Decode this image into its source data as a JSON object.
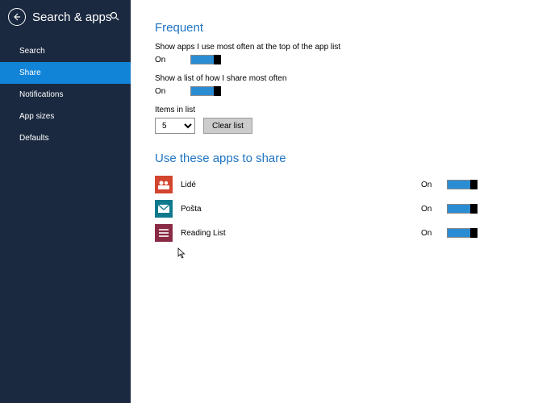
{
  "header": {
    "title": "Search & apps"
  },
  "sidebar": {
    "items": [
      {
        "label": "Search"
      },
      {
        "label": "Share"
      },
      {
        "label": "Notifications"
      },
      {
        "label": "App sizes"
      },
      {
        "label": "Defaults"
      }
    ]
  },
  "frequent": {
    "heading": "Frequent",
    "opt1_desc": "Show apps I use most often at the top of the app list",
    "opt1_state": "On",
    "opt2_desc": "Show a list of how I share most often",
    "opt2_state": "On",
    "items_label": "Items in list",
    "items_value": "5",
    "clear_label": "Clear list"
  },
  "apps": {
    "heading": "Use these apps to share",
    "list": [
      {
        "name": "Lidé",
        "state": "On",
        "icon": "people-icon",
        "color": "#d3452e"
      },
      {
        "name": "Pošta",
        "state": "On",
        "icon": "mail-icon",
        "color": "#0f7a8c"
      },
      {
        "name": "Reading List",
        "state": "On",
        "icon": "reading-list-icon",
        "color": "#8a2b46"
      }
    ]
  }
}
